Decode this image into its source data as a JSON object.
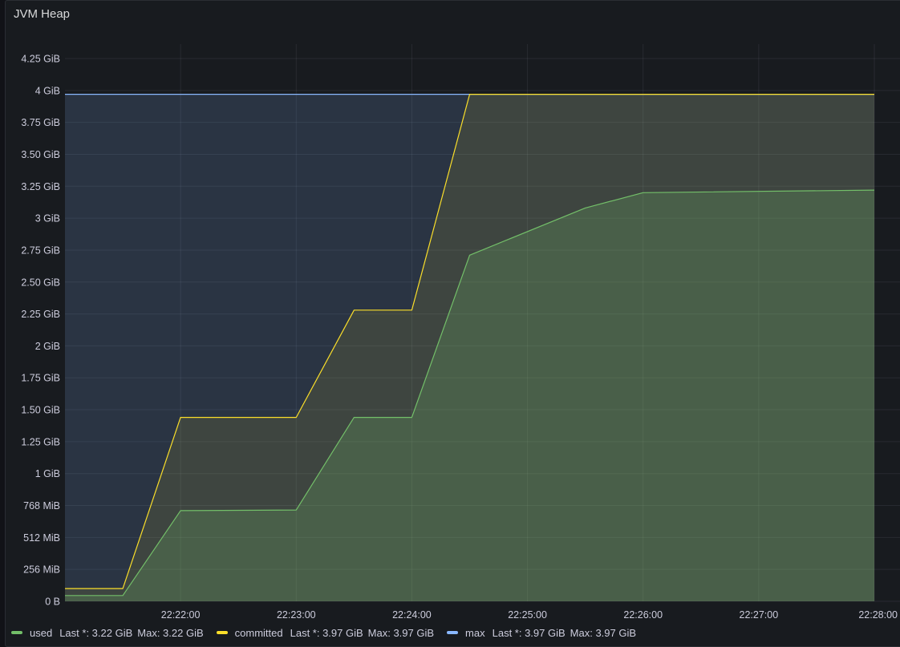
{
  "panel": {
    "title": "JVM Heap"
  },
  "chart_data": {
    "type": "area",
    "title": "JVM Heap",
    "xlabel": "",
    "ylabel": "",
    "x_domain": [
      "22:21:00",
      "22:28:00"
    ],
    "x_ticks": [
      "22:22:00",
      "22:23:00",
      "22:24:00",
      "22:25:00",
      "22:26:00",
      "22:27:00",
      "22:28:00"
    ],
    "y_ticks": [
      {
        "value": 0,
        "label": "0 B"
      },
      {
        "value": 0.25,
        "label": "256 MiB"
      },
      {
        "value": 0.5,
        "label": "512 MiB"
      },
      {
        "value": 0.75,
        "label": "768 MiB"
      },
      {
        "value": 1.0,
        "label": "1 GiB"
      },
      {
        "value": 1.25,
        "label": "1.25 GiB"
      },
      {
        "value": 1.5,
        "label": "1.50 GiB"
      },
      {
        "value": 1.75,
        "label": "1.75 GiB"
      },
      {
        "value": 2.0,
        "label": "2 GiB"
      },
      {
        "value": 2.25,
        "label": "2.25 GiB"
      },
      {
        "value": 2.5,
        "label": "2.50 GiB"
      },
      {
        "value": 2.75,
        "label": "2.75 GiB"
      },
      {
        "value": 3.0,
        "label": "3 GiB"
      },
      {
        "value": 3.25,
        "label": "3.25 GiB"
      },
      {
        "value": 3.5,
        "label": "3.50 GiB"
      },
      {
        "value": 3.75,
        "label": "3.75 GiB"
      },
      {
        "value": 4.0,
        "label": "4 GiB"
      },
      {
        "value": 4.25,
        "label": "4.25 GiB"
      }
    ],
    "ylim": [
      0,
      4.25
    ],
    "y_unit": "GiB",
    "grid": true,
    "legend_position": "bottom",
    "series": [
      {
        "name": "max",
        "color": "#8ab8ff",
        "fill": "rgba(138,184,255,0.16)",
        "x": [
          "22:21:00",
          "22:28:00"
        ],
        "values": [
          3.97,
          3.97
        ]
      },
      {
        "name": "committed",
        "color": "#fade2a",
        "fill": "rgba(250,222,42,0.10)",
        "x": [
          "22:21:00",
          "22:21:30",
          "22:22:00",
          "22:23:00",
          "22:23:30",
          "22:24:00",
          "22:24:30",
          "22:28:00"
        ],
        "values": [
          0.1,
          0.1,
          1.44,
          1.44,
          2.28,
          2.28,
          3.97,
          3.97
        ]
      },
      {
        "name": "used",
        "color": "#73bf69",
        "fill": "rgba(115,191,105,0.22)",
        "x": [
          "22:21:00",
          "22:21:30",
          "22:22:00",
          "22:23:00",
          "22:23:30",
          "22:24:00",
          "22:24:30",
          "22:25:30",
          "22:26:00",
          "22:28:00"
        ],
        "values": [
          0.045,
          0.045,
          0.71,
          0.715,
          1.44,
          1.44,
          2.71,
          3.08,
          3.2,
          3.22
        ]
      }
    ]
  },
  "legend": [
    {
      "name": "used",
      "color": "#73bf69",
      "last": "Last *: 3.22 GiB",
      "max": "Max: 3.22 GiB"
    },
    {
      "name": "committed",
      "color": "#fade2a",
      "last": "Last *: 3.97 GiB",
      "max": "Max: 3.97 GiB"
    },
    {
      "name": "max",
      "color": "#8ab8ff",
      "last": "Last *: 3.97 GiB",
      "max": "Max: 3.97 GiB"
    }
  ]
}
